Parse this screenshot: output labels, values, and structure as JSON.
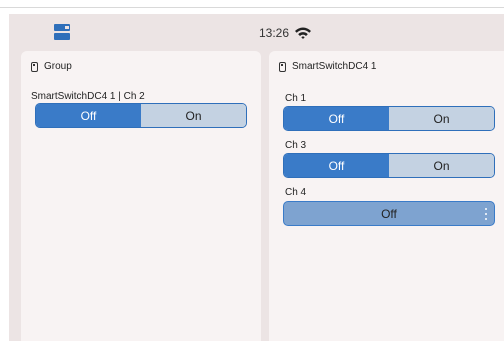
{
  "status": {
    "time": "13:26"
  },
  "group_card": {
    "title": "Group",
    "channel_label": "SmartSwitchDC4 1 | Ch 2",
    "off_label": "Off",
    "on_label": "On"
  },
  "device_card": {
    "title": "SmartSwitchDC4 1",
    "channels": [
      {
        "label": "Ch 1",
        "off_label": "Off",
        "on_label": "On"
      },
      {
        "label": "Ch 3",
        "off_label": "Off",
        "on_label": "On"
      },
      {
        "label": "Ch 4",
        "value_label": "Off"
      }
    ]
  },
  "colors": {
    "accent": "#3a7bc8",
    "inactive": "#c4d2e2",
    "background": "#ece4e4",
    "card": "#f8f3f3"
  },
  "icons": {
    "app": "grid-icon",
    "wifi": "wifi-icon",
    "device": "switch-device-icon",
    "more": "more-vert-icon"
  }
}
